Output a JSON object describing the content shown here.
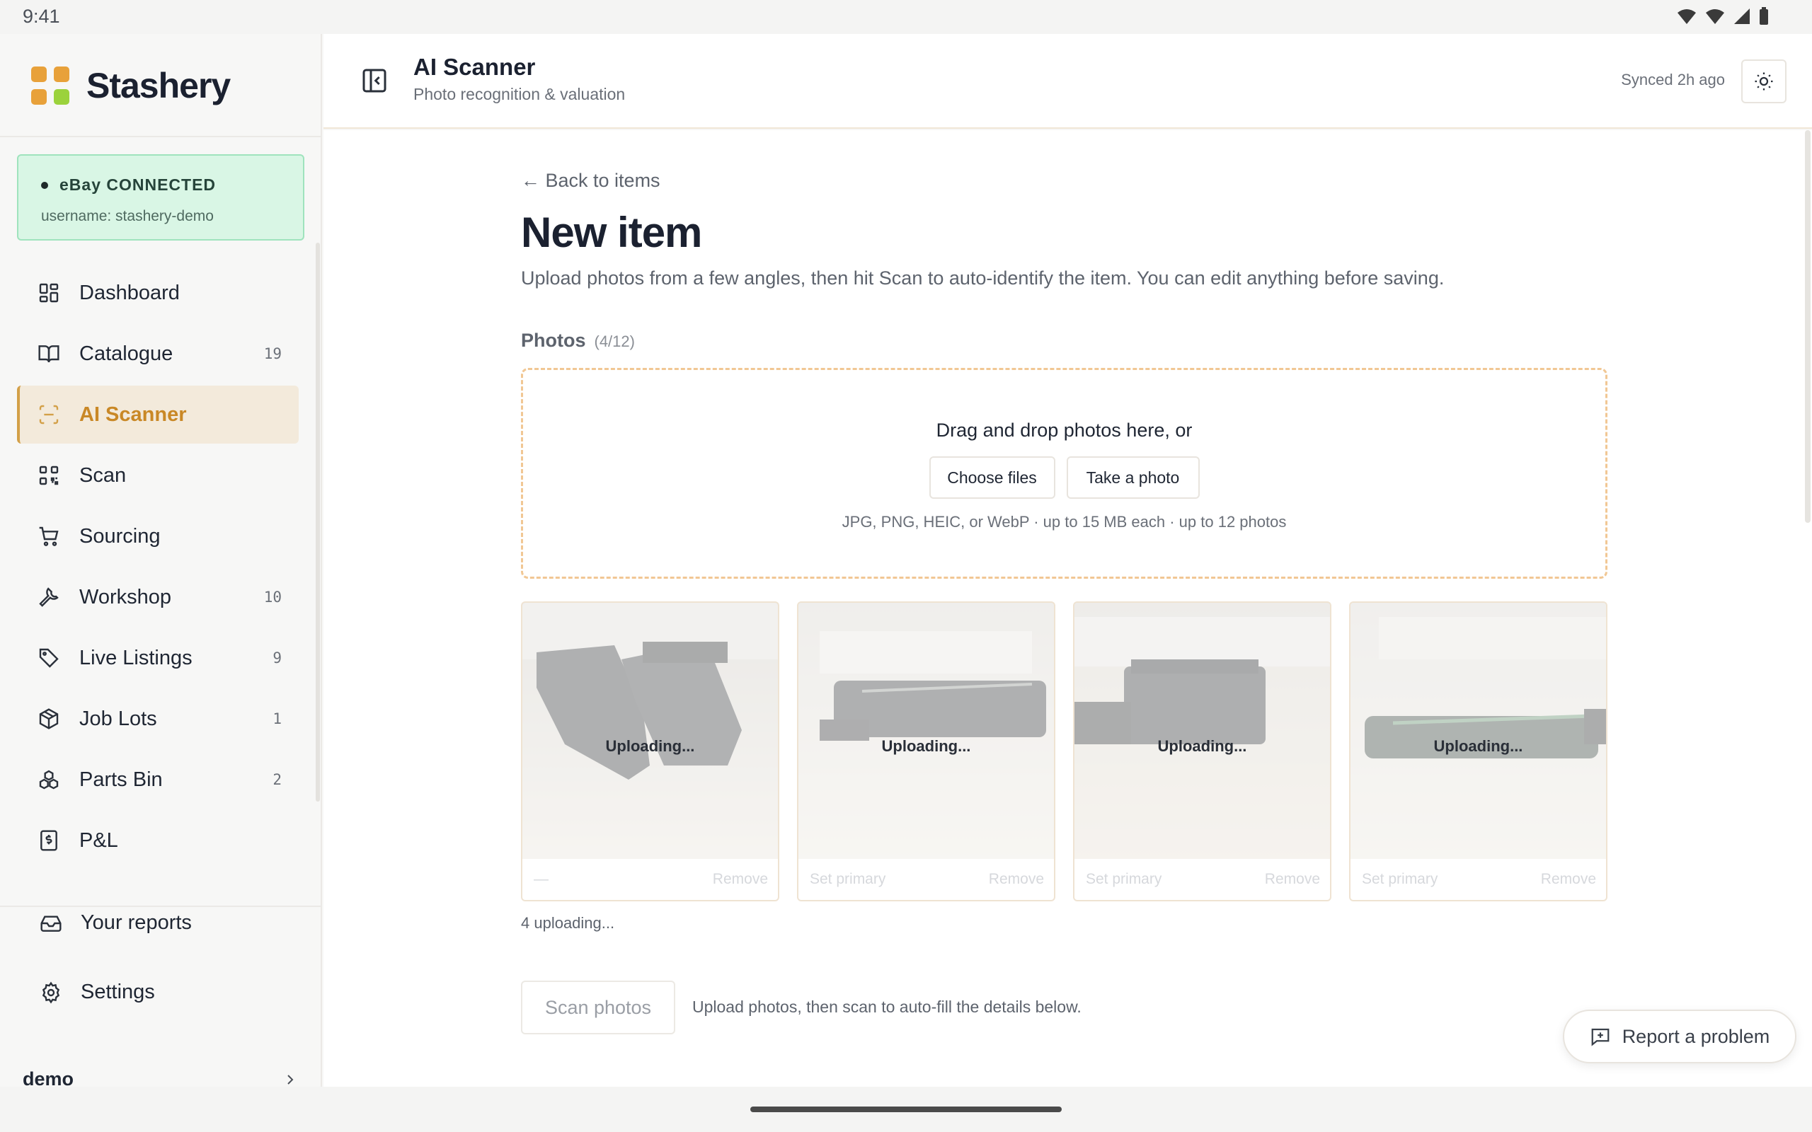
{
  "status_bar": {
    "time": "9:41"
  },
  "brand": {
    "name": "Stashery",
    "logo_colors": [
      "#e8a13a",
      "#e8a13a",
      "#e8a13a",
      "#9bd23c"
    ]
  },
  "ebay": {
    "status": "eBay CONNECTED",
    "username": "username: stashery-demo"
  },
  "sidebar": {
    "items": [
      {
        "label": "Dashboard",
        "icon": "dashboard-icon",
        "count": ""
      },
      {
        "label": "Catalogue",
        "icon": "book-icon",
        "count": "19"
      },
      {
        "label": "AI Scanner",
        "icon": "scan-frame-icon",
        "count": "",
        "active": true
      },
      {
        "label": "Scan",
        "icon": "qr-code-icon",
        "count": ""
      },
      {
        "label": "Sourcing",
        "icon": "cart-icon",
        "count": ""
      },
      {
        "label": "Workshop",
        "icon": "wrench-icon",
        "count": "10"
      },
      {
        "label": "Live Listings",
        "icon": "tag-icon",
        "count": "9"
      },
      {
        "label": "Job Lots",
        "icon": "package-icon",
        "count": "1"
      },
      {
        "label": "Parts Bin",
        "icon": "boxes-icon",
        "count": "2"
      },
      {
        "label": "P&L",
        "icon": "receipt-icon",
        "count": ""
      }
    ],
    "reports_label": "Your reports",
    "settings_label": "Settings",
    "user_name": "demo"
  },
  "header": {
    "title": "AI Scanner",
    "subtitle": "Photo recognition & valuation",
    "synced": "Synced 2h ago"
  },
  "main": {
    "back_link": "← Back to items",
    "title": "New item",
    "description": "Upload photos from a few angles, then hit Scan to auto-identify the item. You can edit anything before saving.",
    "photos_label": "Photos",
    "photos_count": "(4/12)",
    "dropzone": {
      "text": "Drag and drop photos here, or",
      "choose_files": "Choose files",
      "take_photo": "Take a photo",
      "hint": "JPG, PNG, HEIC, or WebP · up to 15 MB each · up to 12 photos"
    },
    "photos": [
      {
        "status": "Uploading...",
        "primary_label": "—",
        "remove_label": "Remove"
      },
      {
        "status": "Uploading...",
        "primary_label": "Set primary",
        "remove_label": "Remove"
      },
      {
        "status": "Uploading...",
        "primary_label": "Set primary",
        "remove_label": "Remove"
      },
      {
        "status": "Uploading...",
        "primary_label": "Set primary",
        "remove_label": "Remove"
      }
    ],
    "uploading_note": "4 uploading...",
    "scan_button": "Scan photos",
    "scan_hint": "Upload photos, then scan to auto-fill the details below.",
    "report_button": "Report a problem"
  },
  "colors": {
    "accent": "#d3a048",
    "ebay_bg": "#d9f6e5",
    "dropzone_border": "#f1c794"
  }
}
